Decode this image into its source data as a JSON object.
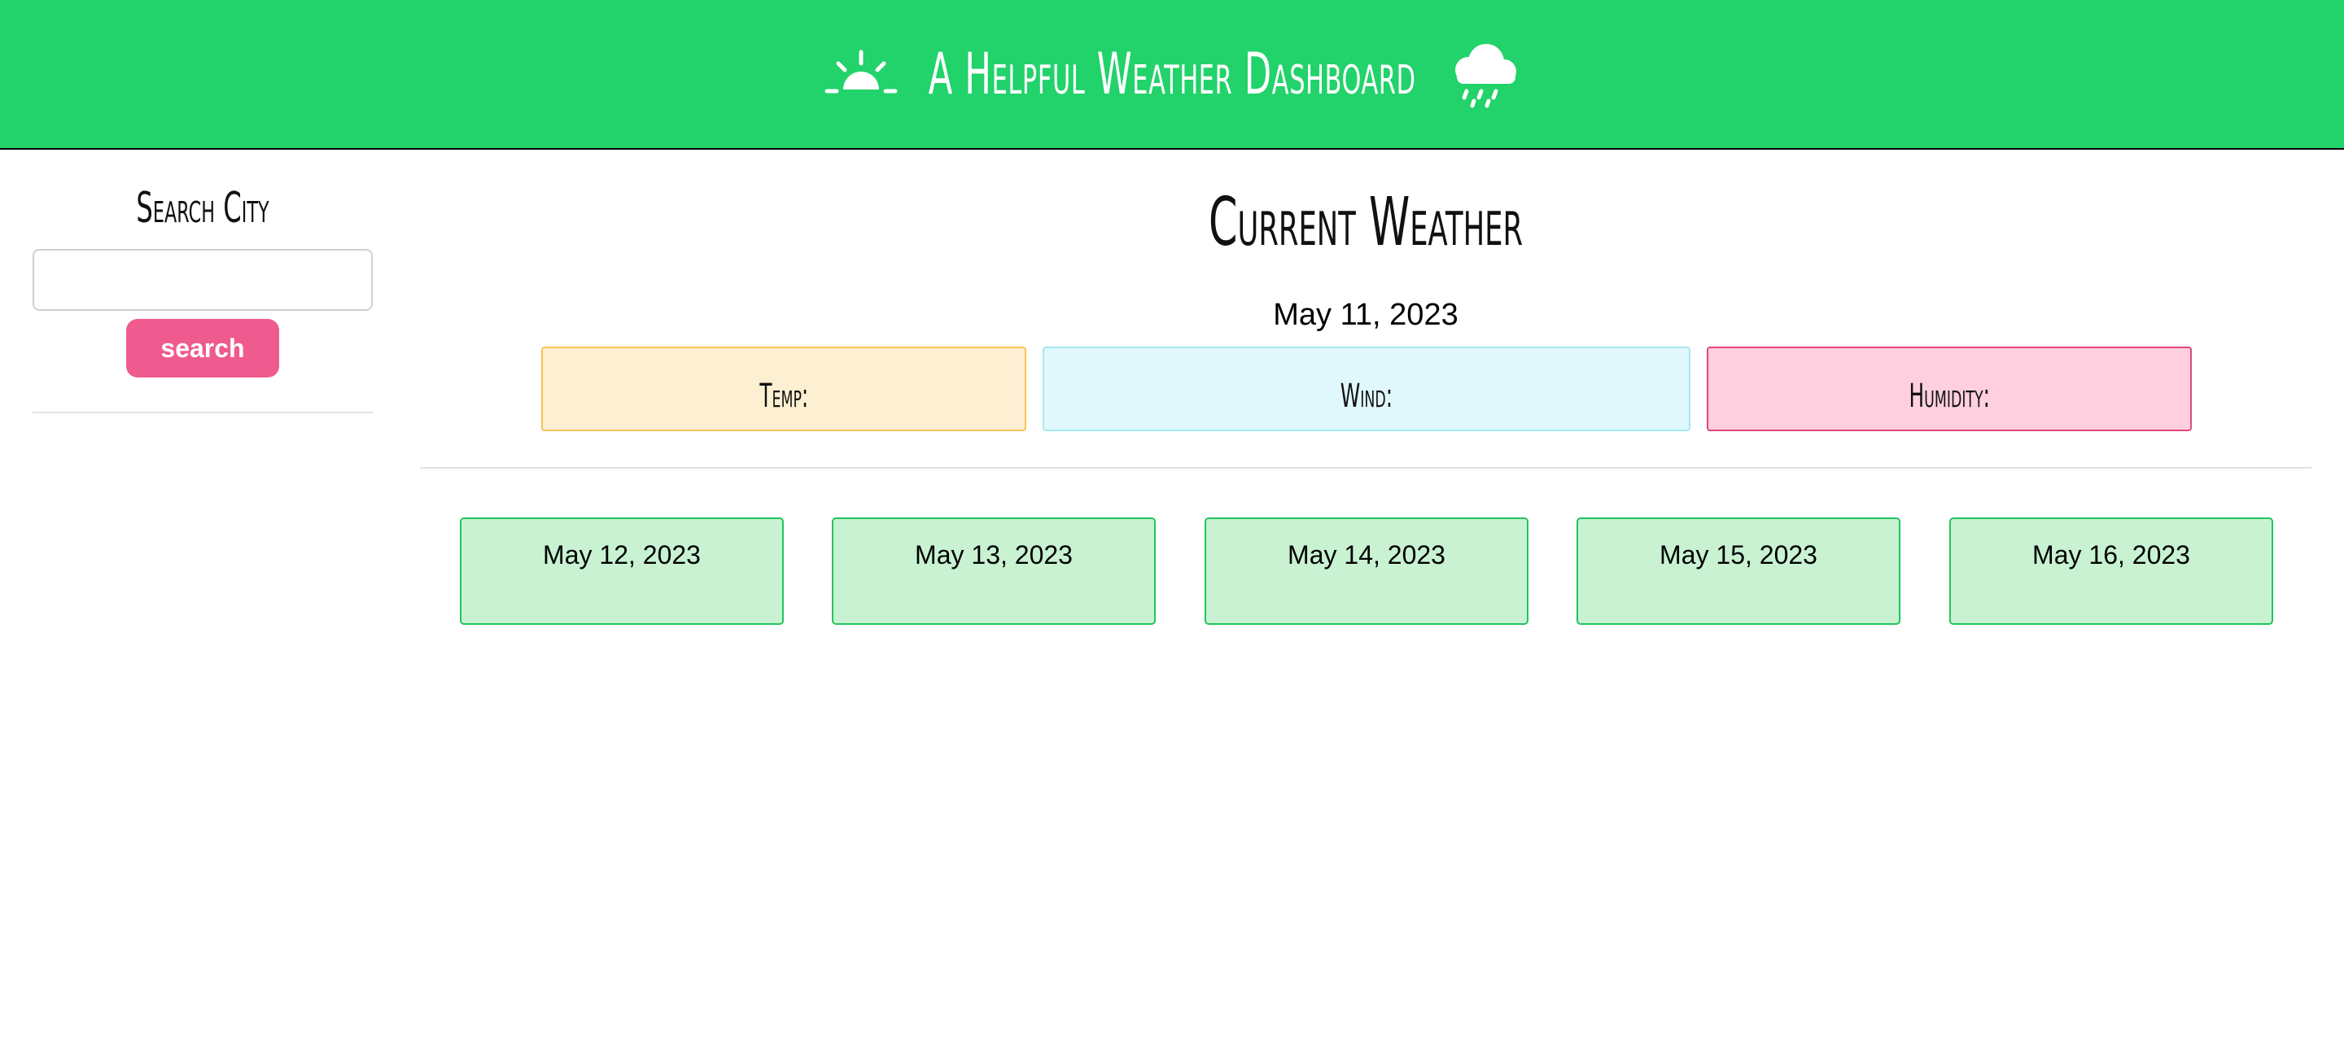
{
  "header": {
    "title": "A Helpful Weather Dashboard",
    "left_icon": "sunrise-icon",
    "right_icon": "cloud-rain-icon"
  },
  "sidebar": {
    "heading": "Search City",
    "search_value": "",
    "search_placeholder": "",
    "search_button_label": "search"
  },
  "current": {
    "heading": "Current Weather",
    "date": "May 11, 2023",
    "temp_label": "Temp:",
    "wind_label": "Wind:",
    "humidity_label": "Humidity:"
  },
  "forecast": [
    {
      "date": "May 12, 2023"
    },
    {
      "date": "May 13, 2023"
    },
    {
      "date": "May 14, 2023"
    },
    {
      "date": "May 15, 2023"
    },
    {
      "date": "May 16, 2023"
    }
  ],
  "colors": {
    "header_bg": "#22d26a",
    "search_button": "#ef5b8e",
    "temp_bg": "#fdefd1",
    "temp_border": "#f6c457",
    "wind_bg": "#e0f8fb",
    "wind_border": "#a6e8f2",
    "humidity_bg": "#fdcfdf",
    "humidity_border": "#e2477e",
    "forecast_bg": "#c8f2d2",
    "forecast_border": "#22c55e"
  }
}
